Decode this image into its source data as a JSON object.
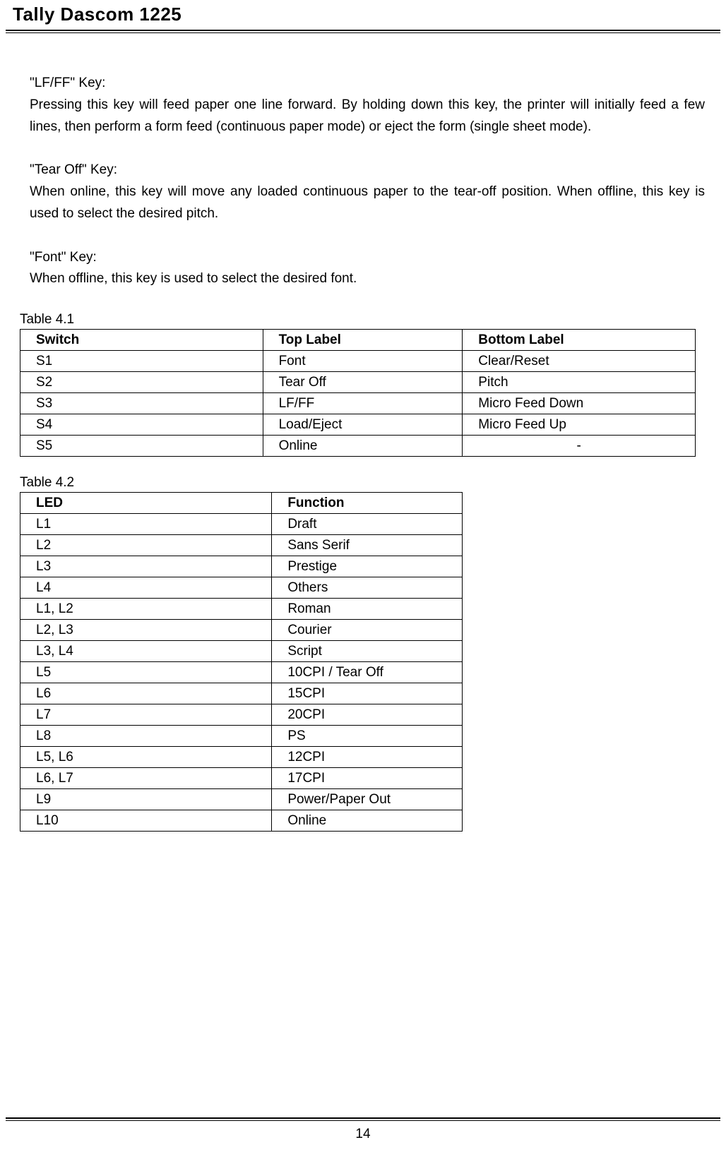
{
  "header": {
    "title": "Tally Dascom 1225"
  },
  "sections": [
    {
      "label": "\"LF/FF\" Key:",
      "text": "Pressing this key will feed paper one line forward. By holding down this key, the printer will initially feed a few lines, then perform a form feed (continuous paper mode) or eject the form (single sheet mode)."
    },
    {
      "label": "\"Tear Off\" Key:",
      "text": "When online, this key will move any loaded continuous paper to the tear-off position. When offline, this key is used to select the desired pitch."
    },
    {
      "label": "\"Font\" Key:",
      "text": "When offline, this key is used to select the desired font."
    }
  ],
  "table41": {
    "caption": "Table 4.1",
    "headers": [
      "Switch",
      "Top Label",
      "Bottom Label"
    ],
    "rows": [
      [
        "S1",
        "Font",
        "Clear/Reset"
      ],
      [
        "S2",
        "Tear Off",
        "Pitch"
      ],
      [
        "S3",
        "LF/FF",
        "Micro Feed Down"
      ],
      [
        "S4",
        "Load/Eject",
        "Micro Feed Up"
      ],
      [
        "S5",
        "Online",
        "-"
      ]
    ]
  },
  "table42": {
    "caption": "Table 4.2",
    "headers": [
      "LED",
      "Function"
    ],
    "rows": [
      [
        "L1",
        "Draft"
      ],
      [
        "L2",
        "Sans Serif"
      ],
      [
        "L3",
        "Prestige"
      ],
      [
        "L4",
        "Others"
      ],
      [
        "L1, L2",
        "Roman"
      ],
      [
        "L2, L3",
        "Courier"
      ],
      [
        "L3, L4",
        "Script"
      ],
      [
        "L5",
        "10CPI / Tear Off"
      ],
      [
        "L6",
        "15CPI"
      ],
      [
        "L7",
        "20CPI"
      ],
      [
        "L8",
        "PS"
      ],
      [
        "L5, L6",
        "12CPI"
      ],
      [
        "L6, L7",
        "17CPI"
      ],
      [
        "L9",
        "Power/Paper Out"
      ],
      [
        "L10",
        "Online"
      ]
    ]
  },
  "footer": {
    "page_number": "14"
  }
}
